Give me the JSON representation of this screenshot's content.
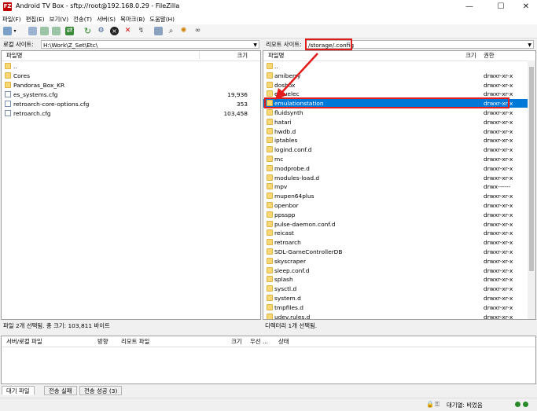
{
  "window": {
    "title": "Android TV Box - sftp://root@192.168.0.29 - FileZilla",
    "app_icon_text": "FZ",
    "minimize": "—",
    "maximize": "☐",
    "close": "✕"
  },
  "menu": [
    "파일(F)",
    "편집(E)",
    "보기(V)",
    "전송(T)",
    "서버(S)",
    "북마크(B)",
    "도움말(H)"
  ],
  "local": {
    "site_label": "로컬 사이트:",
    "site_path": "H:\\Work\\Z_Set\\Etc\\",
    "col_name": "파일명",
    "col_size": "크기",
    "items": [
      {
        "name": "..",
        "size": "",
        "type": "folder"
      },
      {
        "name": "Cores",
        "size": "",
        "type": "folder"
      },
      {
        "name": "Pandoras_Box_KR",
        "size": "",
        "type": "folder"
      },
      {
        "name": "es_systems.cfg",
        "size": "19,936",
        "type": "file"
      },
      {
        "name": "retroarch-core-options.cfg",
        "size": "353",
        "type": "file"
      },
      {
        "name": "retroarch.cfg",
        "size": "103,458",
        "type": "file"
      }
    ],
    "status": "파일 2개 선택됨. 총 크기: 103,811 바이트"
  },
  "remote": {
    "site_label": "리모트 사이트:",
    "site_path": "/storage/.config",
    "col_name": "파일명",
    "col_size": "크기",
    "col_perm": "권한",
    "items": [
      {
        "name": "..",
        "perm": ""
      },
      {
        "name": "amiberry",
        "perm": "drwxr-xr-x"
      },
      {
        "name": "dosbox",
        "perm": "drwxr-xr-x"
      },
      {
        "name": "emuelec",
        "perm": "drwxr-xr-x"
      },
      {
        "name": "emulationstation",
        "perm": "drwxr-xr-x"
      },
      {
        "name": "fluidsynth",
        "perm": "drwxr-xr-x"
      },
      {
        "name": "hatari",
        "perm": "drwxr-xr-x"
      },
      {
        "name": "hwdb.d",
        "perm": "drwxr-xr-x"
      },
      {
        "name": "iptables",
        "perm": "drwxr-xr-x"
      },
      {
        "name": "logind.conf.d",
        "perm": "drwxr-xr-x"
      },
      {
        "name": "mc",
        "perm": "drwxr-xr-x"
      },
      {
        "name": "modprobe.d",
        "perm": "drwxr-xr-x"
      },
      {
        "name": "modules-load.d",
        "perm": "drwxr-xr-x"
      },
      {
        "name": "mpv",
        "perm": "drwx------"
      },
      {
        "name": "mupen64plus",
        "perm": "drwxr-xr-x"
      },
      {
        "name": "openbor",
        "perm": "drwxr-xr-x"
      },
      {
        "name": "ppsspp",
        "perm": "drwxr-xr-x"
      },
      {
        "name": "pulse-daemon.conf.d",
        "perm": "drwxr-xr-x"
      },
      {
        "name": "reicast",
        "perm": "drwxr-xr-x"
      },
      {
        "name": "retroarch",
        "perm": "drwxr-xr-x"
      },
      {
        "name": "SDL-GameControllerDB",
        "perm": "drwxr-xr-x"
      },
      {
        "name": "skyscraper",
        "perm": "drwxr-xr-x"
      },
      {
        "name": "sleep.conf.d",
        "perm": "drwxr-xr-x"
      },
      {
        "name": "splash",
        "perm": "drwxr-xr-x"
      },
      {
        "name": "sysctl.d",
        "perm": "drwxr-xr-x"
      },
      {
        "name": "system.d",
        "perm": "drwxr-xr-x"
      },
      {
        "name": "tmpfiles.d",
        "perm": "drwxr-xr-x"
      },
      {
        "name": "udev.rules.d",
        "perm": "drwxr-xr-x"
      }
    ],
    "selected_index": 4,
    "status": "디렉터리 1개 선택됨."
  },
  "queue": {
    "columns": [
      "서버/로컬 파일",
      "방향",
      "리모트 파일",
      "크기",
      "우선 ...",
      "상태"
    ],
    "tabs": [
      "대기 파일",
      "전송 실패",
      "전송 성공 (3)"
    ]
  },
  "statusbar": {
    "queue_text": "대기열: 비었음"
  },
  "annotation_color": "#e21b1b",
  "selection_color": "#0078d7"
}
